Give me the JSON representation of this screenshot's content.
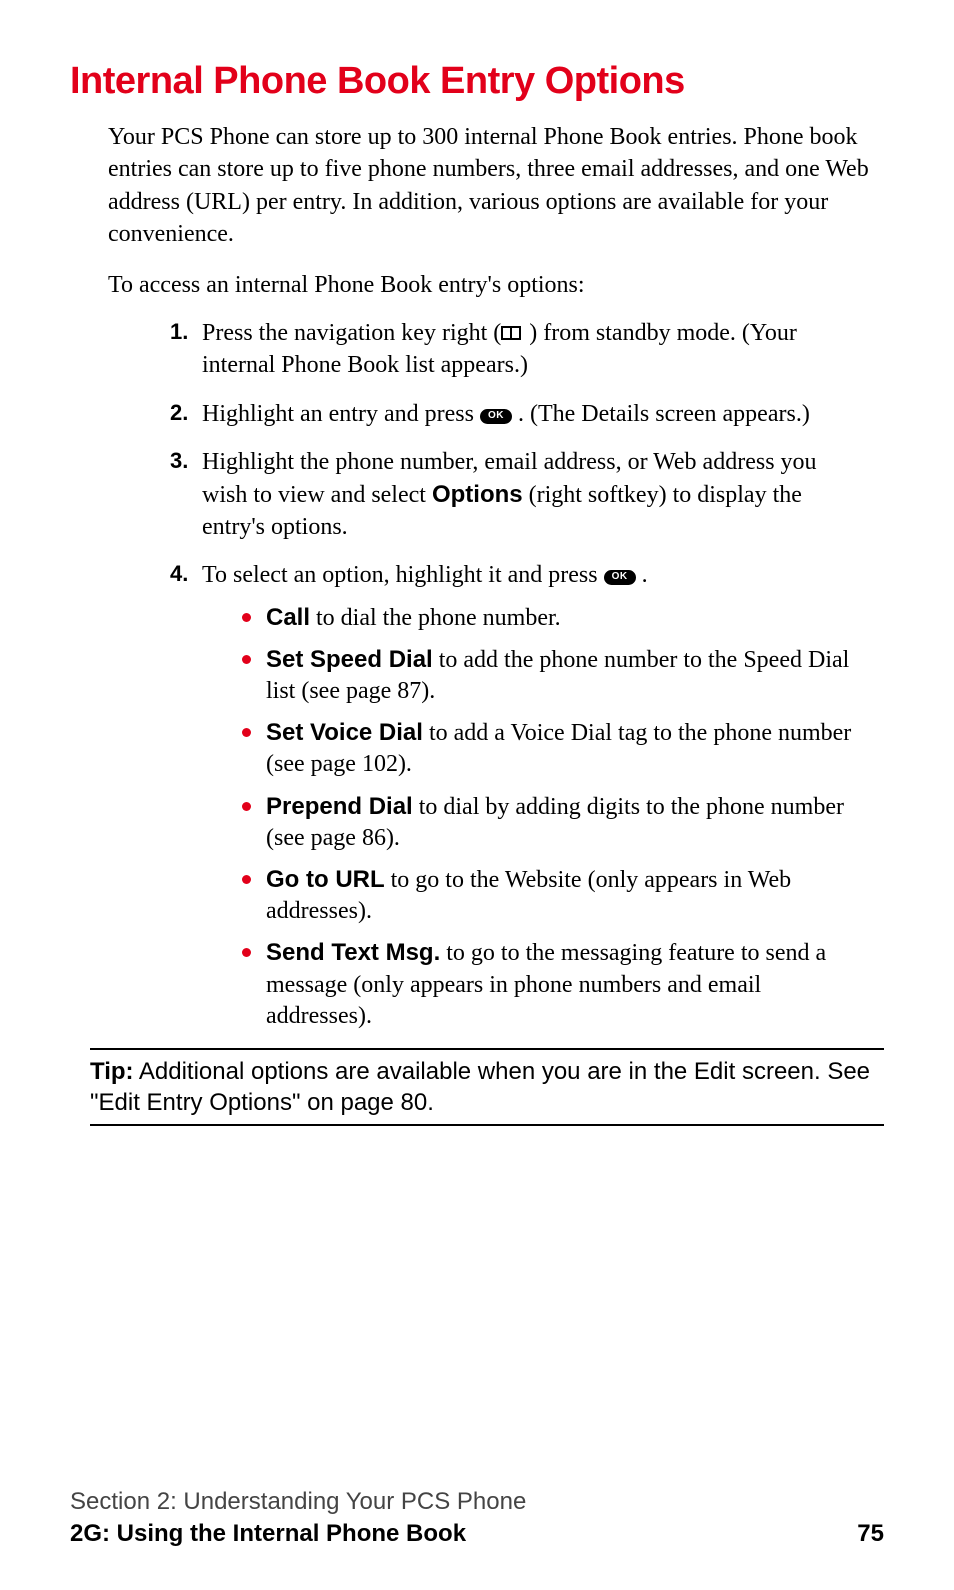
{
  "heading": "Internal Phone Book Entry Options",
  "intro": "Your PCS Phone can store up to 300 internal Phone Book entries. Phone book entries can store up to five phone numbers, three email addresses, and one Web address (URL) per entry. In addition, various options are available for your convenience.",
  "lead": "To access an internal Phone Book entry's options:",
  "steps": {
    "s1": {
      "num": "1.",
      "a": "Press the navigation key right (",
      "b": ") from standby mode. (Your internal Phone Book list appears.)"
    },
    "s2": {
      "num": "2.",
      "a": "Highlight an entry and press ",
      "ok": "OK",
      "b": ". (The Details screen appears.)"
    },
    "s3": {
      "num": "3.",
      "a": "Highlight the phone number, email address, or Web address you wish to view and select ",
      "bold": "Options",
      "b": " (right softkey) to display the entry's options."
    },
    "s4": {
      "num": "4.",
      "a": "To select an option, highlight it and press ",
      "ok": "OK",
      "b": "."
    }
  },
  "bullets": {
    "b1": {
      "bold": "Call",
      "text": " to dial the phone number."
    },
    "b2": {
      "bold": "Set Speed Dial",
      "text": " to add the phone number to the Speed Dial list (see page 87)."
    },
    "b3": {
      "bold": "Set Voice Dial",
      "text": " to add a Voice Dial tag to the phone number (see page 102)."
    },
    "b4": {
      "bold": "Prepend Dial",
      "text": " to dial by adding digits to the phone number (see page 86)."
    },
    "b5": {
      "bold": "Go to URL",
      "text": " to go to the Website (only appears in Web addresses)."
    },
    "b6": {
      "bold": "Send Text Msg.",
      "text": " to go to the messaging feature to send a message (only appears in phone numbers and email addresses)."
    }
  },
  "tip": {
    "label": "Tip:",
    "text": " Additional options are available when you are in the Edit screen. See \"Edit Entry Options\" on page 80."
  },
  "footer": {
    "section": "Section 2: Understanding Your PCS Phone",
    "chapter": "2G: Using the Internal Phone Book",
    "page": "75"
  }
}
